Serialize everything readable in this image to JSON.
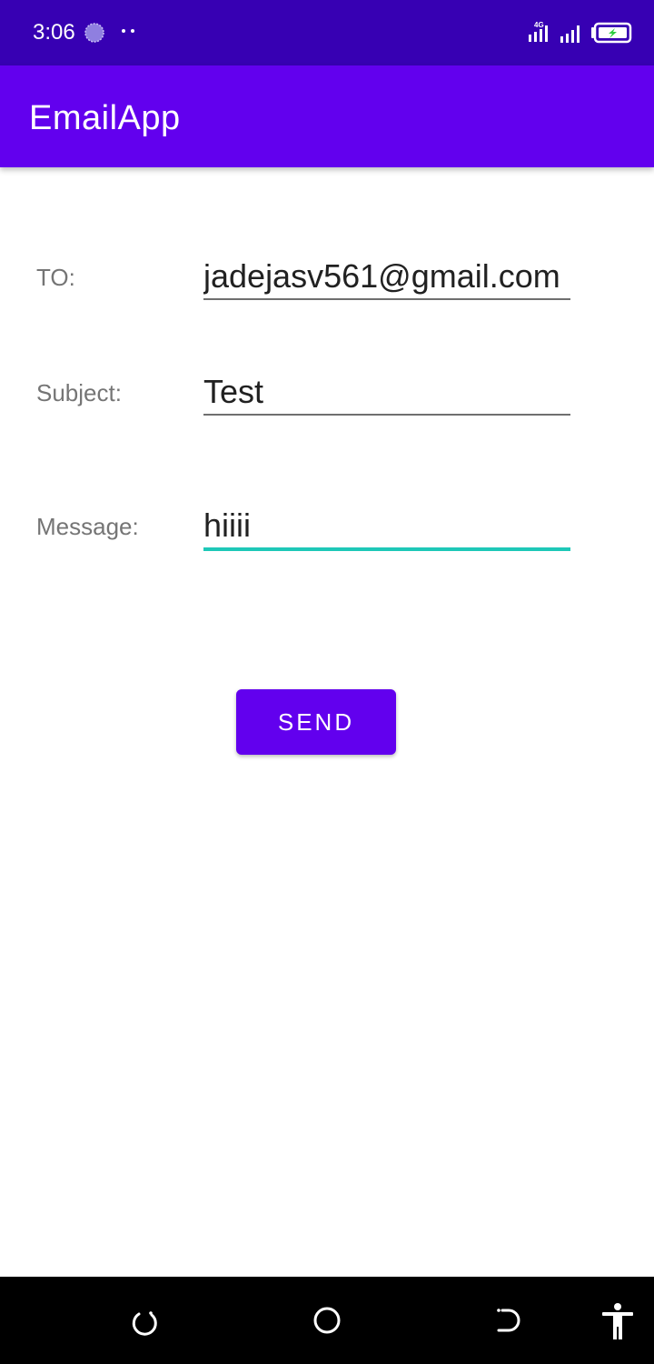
{
  "status_bar": {
    "time": "3:06",
    "network": "4G",
    "icons": [
      "loading-spinner-icon",
      "more-dots-icon",
      "signal-4g-icon",
      "signal-bars-icon",
      "battery-charging-icon"
    ]
  },
  "app_bar": {
    "title": "EmailApp"
  },
  "form": {
    "to": {
      "label": "TO:",
      "value": "jadejasv561@gmail.com"
    },
    "subject": {
      "label": "Subject:",
      "value": "Test"
    },
    "message": {
      "label": "Message:",
      "value": "hiiii"
    }
  },
  "send_button": {
    "label": "SEND"
  },
  "nav_bar": {
    "icons": [
      "recents-icon",
      "home-icon",
      "back-icon",
      "accessibility-icon"
    ]
  },
  "colors": {
    "status_bar": "#3700b3",
    "primary": "#6200ee",
    "accent_focus": "#1ec8b8",
    "label_gray": "#757575",
    "nav_bar": "#000000"
  }
}
